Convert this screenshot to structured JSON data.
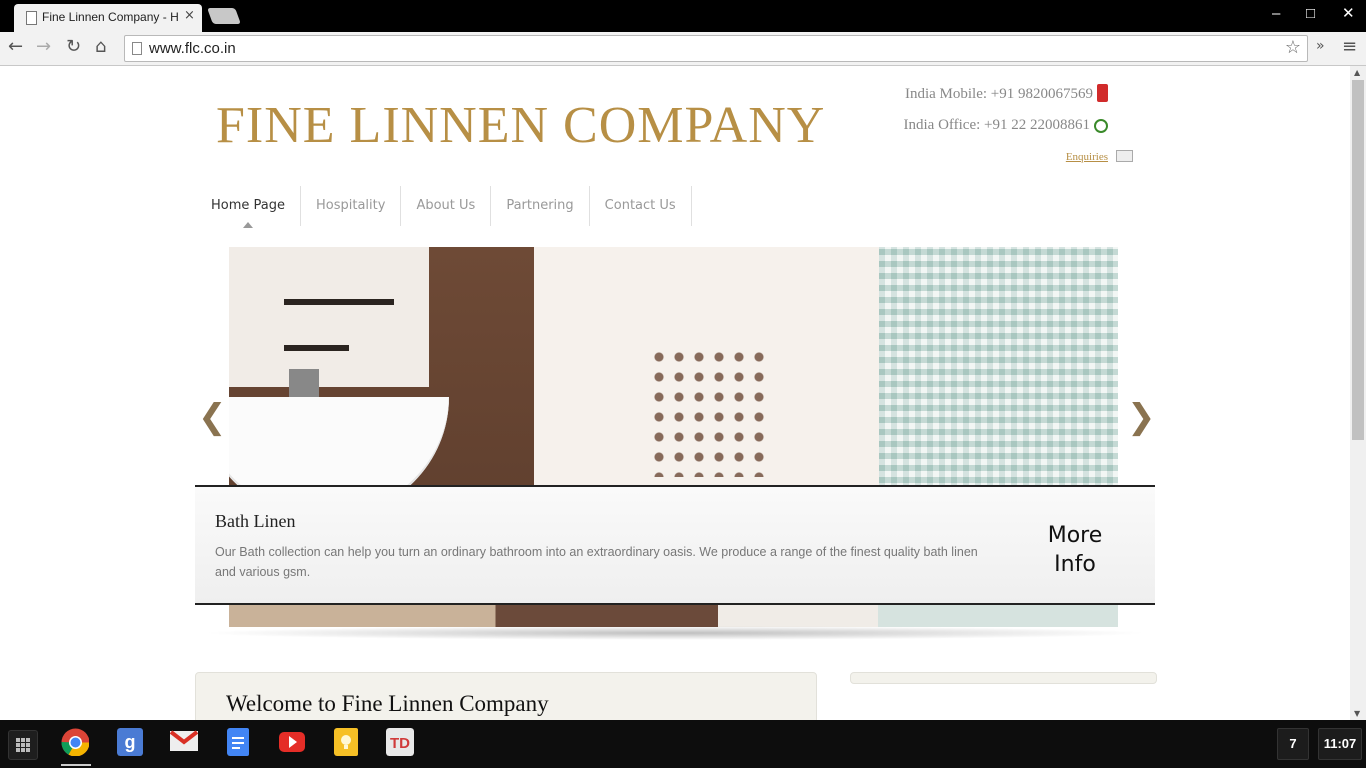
{
  "browser": {
    "tab_title": "Fine Linnen Company - H",
    "tab_close": "×",
    "url": "www.flc.co.in",
    "window_min": "–",
    "window_max": "□",
    "window_close": "✕",
    "nav_back": "←",
    "nav_forward": "→",
    "nav_reload": "↻",
    "nav_home": "⌂",
    "bookmark_star": "☆",
    "overflow": "»",
    "menu": "≡"
  },
  "header": {
    "logo": "FINE LINNEN COMPANY",
    "mobile": "India Mobile: +91 9820067569",
    "office": "India Office: +91 22 22008861",
    "enquiries": "Enquiries"
  },
  "nav": {
    "items": [
      {
        "label": "Home Page"
      },
      {
        "label": "Hospitality"
      },
      {
        "label": "About Us"
      },
      {
        "label": "Partnering"
      },
      {
        "label": "Contact Us"
      }
    ]
  },
  "slider": {
    "prev": "❮",
    "next": "❯",
    "caption_title": "Bath Linen",
    "caption_text": "Our Bath collection can help you turn an ordinary bathroom into an extraordinary oasis. We produce a range of the finest quality bath linen and various gsm.",
    "more_info_line1": "More",
    "more_info_line2": "Info"
  },
  "content": {
    "welcome_title": "Welcome to Fine Linnen Company"
  },
  "shelf": {
    "apps": [
      "chrome-icon",
      "google-search-icon",
      "gmail-icon",
      "docs-icon",
      "youtube-icon",
      "keep-icon",
      "tweetdeck-icon"
    ],
    "notifications": "7",
    "clock": "11:07"
  },
  "colors": {
    "brand_gold": "#b78f45",
    "caption_border": "#222222"
  }
}
